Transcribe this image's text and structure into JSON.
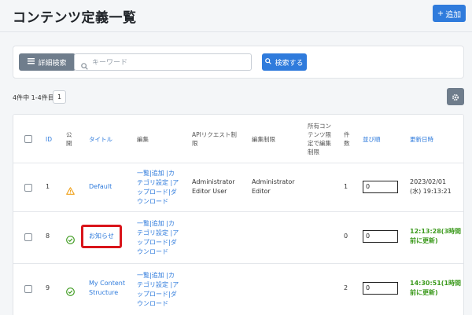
{
  "header": {
    "title": "コンテンツ定義一覧",
    "add_label": "追加"
  },
  "search": {
    "advanced_label": "詳細検索",
    "placeholder": "キーワード",
    "value": "",
    "button_label": "検索する"
  },
  "pagination": {
    "count_text": "4件中 1-4件目",
    "current_page": "1"
  },
  "table": {
    "headers": {
      "id": "ID",
      "public": "公\n開",
      "title": "タイトル",
      "edit": "編集",
      "api_limit": "APIリクエスト制\n限",
      "edit_limit": "編集制限",
      "owner_limit": "所有コン\nテンツ限\n定で編集\n制限",
      "count": "件\n数",
      "order": "並び順",
      "updated": "更新日時"
    },
    "rows": [
      {
        "id": "1",
        "status": "warning",
        "title": "Default",
        "edit_links": "一覧|追加 |カ\nテゴリ設定 |ア\nップロード|ダ\nウンロード",
        "api_limit": "Administrator\nEditor User",
        "edit_limit": "Administrator\nEditor",
        "count": "1",
        "order": "0",
        "updated": "2023/02/01\n(水) 19:13:21",
        "updated_green": false
      },
      {
        "id": "8",
        "status": "check",
        "title": "お知らせ",
        "edit_links": "一覧|追加 |カ\nテゴリ設定 |ア\nップロード|ダ\nウンロード",
        "api_limit": "",
        "edit_limit": "",
        "count": "0",
        "order": "0",
        "updated": "12:13:28(3時間\n前に更新)",
        "updated_green": true
      },
      {
        "id": "9",
        "status": "check",
        "title": "My Content\nStructure",
        "edit_links": "一覧|追加 |カ\nテゴリ設定 |ア\nップロード|ダ\nウンロード",
        "api_limit": "",
        "edit_limit": "",
        "count": "2",
        "order": "0",
        "updated": "14:30:51(1時間\n前に更新)",
        "updated_green": true
      }
    ]
  },
  "colors": {
    "accent": "#2f7bdc",
    "warning": "#f0a21c",
    "success": "#3c9a1d",
    "highlight": "#d9141a"
  },
  "icons": {
    "add": "plus-icon",
    "advanced": "list-icon",
    "search": "search-icon",
    "settings": "gear-icon",
    "warning": "warning-icon",
    "check": "check-circle-icon"
  }
}
